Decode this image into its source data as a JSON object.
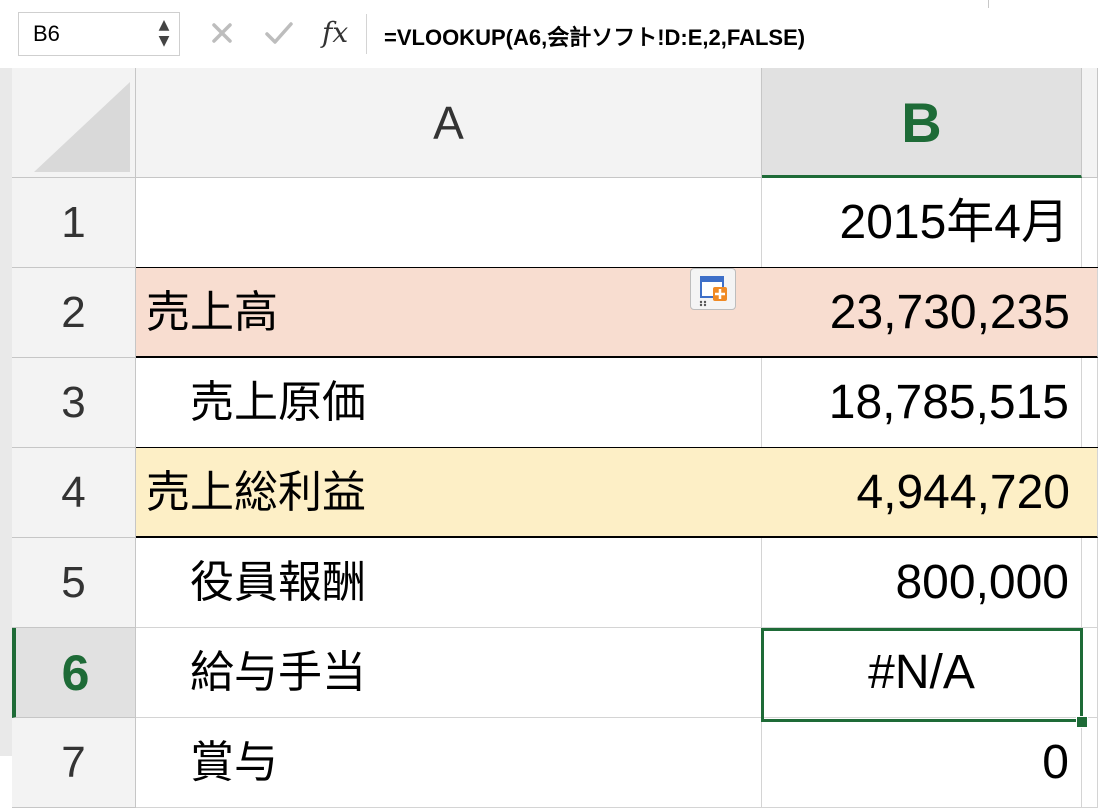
{
  "formula_bar": {
    "name_box": "B6",
    "formula": "=VLOOKUP(A6,会計ソフト!D:E,2,FALSE)",
    "fx_label": "fx"
  },
  "columns": [
    {
      "label": "A",
      "selected": false
    },
    {
      "label": "B",
      "selected": true
    }
  ],
  "rows": [
    {
      "number": "1",
      "a": "",
      "b": "2015年4月"
    },
    {
      "number": "2",
      "a": "売上高",
      "b": "23,730,235"
    },
    {
      "number": "3",
      "a": "売上原価",
      "b": "18,785,515"
    },
    {
      "number": "4",
      "a": "売上総利益",
      "b": "4,944,720"
    },
    {
      "number": "5",
      "a": "役員報酬",
      "b": "800,000"
    },
    {
      "number": "6",
      "a": "給与手当",
      "b": "#N/A"
    },
    {
      "number": "7",
      "a": "賞与",
      "b": "0"
    }
  ],
  "colors": {
    "accent": "#1e6b37",
    "sales_row": "#f8ddd0",
    "gross_profit_row": "#fdefc6"
  },
  "icons": {
    "cancel": "close-icon",
    "enter": "check-icon",
    "function": "fx-icon",
    "paste_options": "paste-options-icon"
  },
  "active_cell": "B6"
}
